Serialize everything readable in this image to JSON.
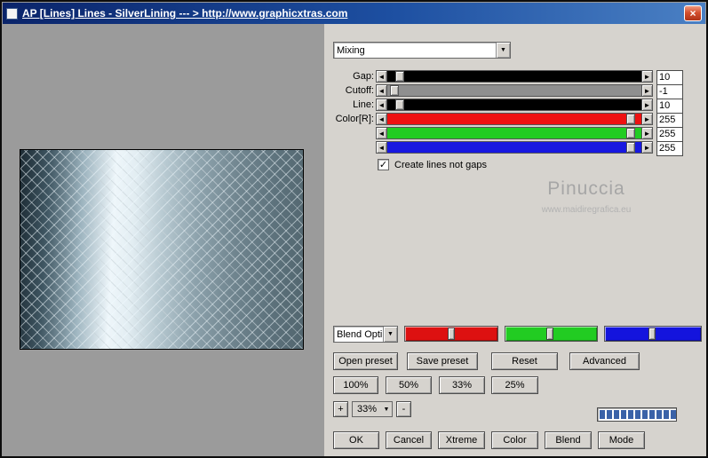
{
  "window": {
    "title": "AP [Lines]  Lines - SilverLining   --- > http://www.graphicxtras.com"
  },
  "icons": {
    "close": "×",
    "check": "✓",
    "arrow_down": "▼",
    "arrow_left": "◄",
    "arrow_right": "►"
  },
  "panel": {
    "mixing_dropdown": {
      "value": "Mixing"
    },
    "sliders": [
      {
        "label": "Gap:",
        "value": "10",
        "track_color": "#000000"
      },
      {
        "label": "Cutoff:",
        "value": "-1",
        "track_color": "#8f8f8f"
      },
      {
        "label": "Line:",
        "value": "10",
        "track_color": "#000000"
      },
      {
        "label": "Color[R]:",
        "value": "255",
        "track_color": "#ee1111"
      },
      {
        "label": "",
        "value": "255",
        "track_color": "#22cc22"
      },
      {
        "label": "",
        "value": "255",
        "track_color": "#1818e0"
      }
    ],
    "checkbox": {
      "label": "Create lines not gaps",
      "checked": true
    },
    "watermark": {
      "name": "Pinuccia",
      "url": "www.maidiregrafica.eu"
    },
    "blend": {
      "dropdown_value": "Blend Opti",
      "channels": [
        {
          "name": "red",
          "color": "#dd1111"
        },
        {
          "name": "green",
          "color": "#22cc22"
        },
        {
          "name": "blue",
          "color": "#1414dd"
        }
      ]
    },
    "preset_buttons": [
      "Open preset",
      "Save preset",
      "Reset",
      "Advanced"
    ],
    "zoom_buttons": [
      "100%",
      "50%",
      "33%",
      "25%"
    ],
    "stepper": {
      "plus": "+",
      "value": "33%",
      "minus": "-"
    },
    "action_buttons": [
      "OK",
      "Cancel",
      "Xtreme",
      "Color",
      "Blend",
      "Mode"
    ],
    "progress": {
      "color": "#3a62a8",
      "fill": "100%"
    }
  }
}
